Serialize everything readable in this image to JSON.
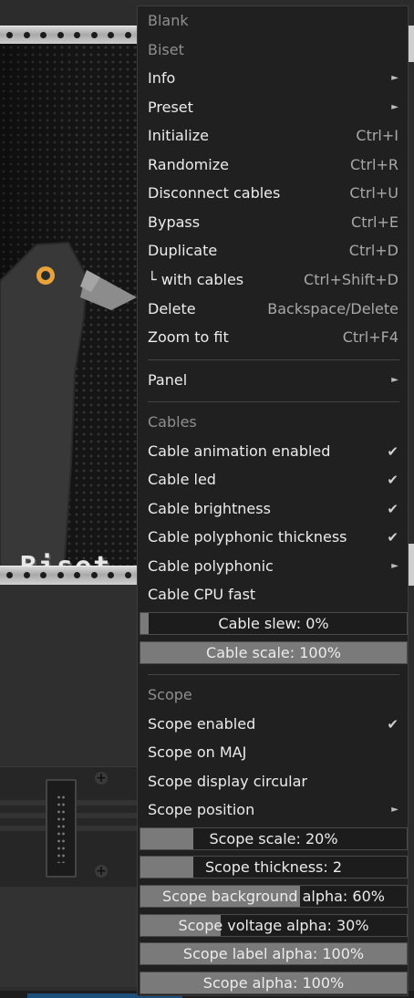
{
  "module": {
    "name": "Biset"
  },
  "menu": {
    "header_items": [
      "Blank",
      "Biset"
    ],
    "items": [
      {
        "label": "Info",
        "submenu": true
      },
      {
        "label": "Preset",
        "submenu": true
      },
      {
        "label": "Initialize",
        "shortcut": "Ctrl+I"
      },
      {
        "label": "Randomize",
        "shortcut": "Ctrl+R"
      },
      {
        "label": "Disconnect cables",
        "shortcut": "Ctrl+U"
      },
      {
        "label": "Bypass",
        "shortcut": "Ctrl+E"
      },
      {
        "label": "Duplicate",
        "shortcut": "Ctrl+D"
      },
      {
        "label": "└ with cables",
        "shortcut": "Ctrl+Shift+D"
      },
      {
        "label": "Delete",
        "shortcut": "Backspace/Delete"
      },
      {
        "label": "Zoom to fit",
        "shortcut": "Ctrl+F4"
      }
    ],
    "panel": {
      "label": "Panel",
      "submenu": true
    },
    "cables": {
      "heading": "Cables",
      "items": [
        {
          "label": "Cable animation enabled",
          "checked": true
        },
        {
          "label": "Cable led",
          "checked": true
        },
        {
          "label": "Cable brightness",
          "checked": true
        },
        {
          "label": "Cable polyphonic thickness",
          "checked": true
        },
        {
          "label": "Cable polyphonic",
          "submenu": true
        },
        {
          "label": "Cable CPU fast",
          "checked": false
        }
      ],
      "sliders": [
        {
          "text": "Cable slew: 0%",
          "value": 0
        },
        {
          "text": "Cable scale: 100%",
          "value": 100
        }
      ]
    },
    "scope": {
      "heading": "Scope",
      "items": [
        {
          "label": "Scope enabled",
          "checked": true
        },
        {
          "label": "Scope on MAJ",
          "checked": false
        },
        {
          "label": "Scope display circular",
          "checked": false
        },
        {
          "label": "Scope position",
          "submenu": true
        }
      ],
      "sliders": [
        {
          "text": "Scope scale: 20%",
          "value": 20
        },
        {
          "text": "Scope thickness: 2",
          "value": 2
        },
        {
          "text": "Scope background alpha: 60%",
          "value": 60
        },
        {
          "text": "Scope voltage alpha: 30%",
          "value": 30
        },
        {
          "text": "Scope label alpha: 100%",
          "value": 100
        },
        {
          "text": "Scope alpha: 100%",
          "value": 100
        }
      ]
    },
    "symbols": {
      "arrow": "►",
      "check": "✔"
    }
  },
  "colors": {
    "menu_bg": "#202020",
    "slider_fill": "#7a7a7a",
    "bird_body": "#3a3a3a",
    "bird_eye": "#e8a23a",
    "beak": "#8a8a8a"
  }
}
